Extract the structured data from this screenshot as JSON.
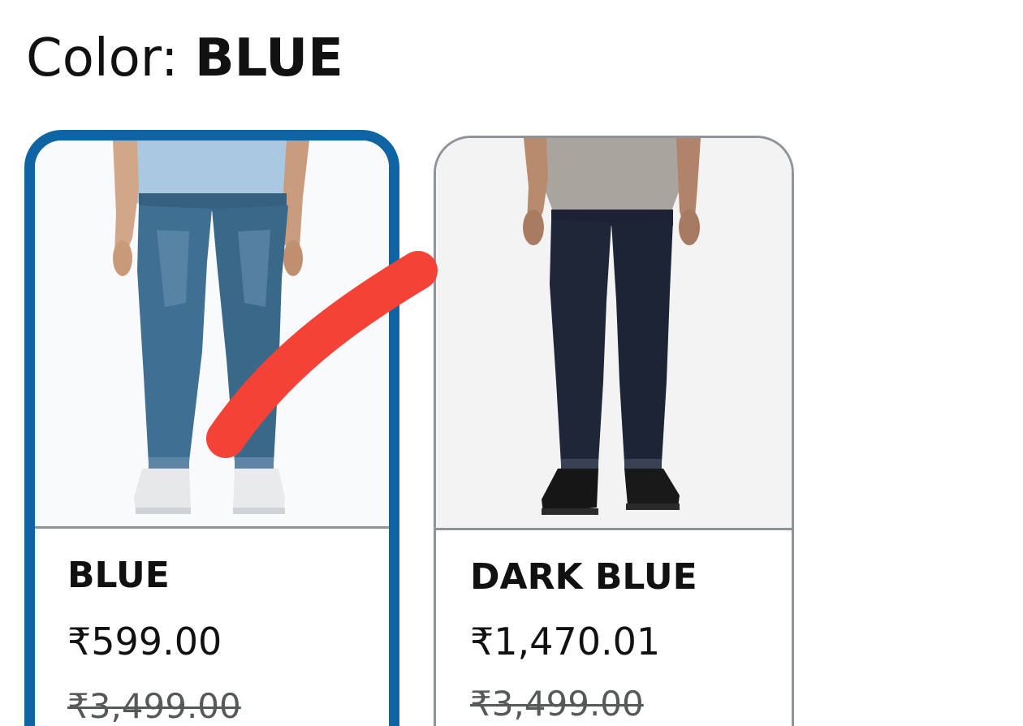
{
  "color_selector": {
    "label_prefix": "Color:",
    "selected_value": "BLUE"
  },
  "swatches": [
    {
      "name": "BLUE",
      "price": "₹599.00",
      "mrp": "₹3,499.00",
      "selected": true,
      "image": "model-wearing-blue-faded-jeans-white-sneakers"
    },
    {
      "name": "DARK BLUE",
      "price": "₹1,470.01",
      "mrp": "₹3,499.00",
      "selected": false,
      "image": "model-wearing-dark-blue-jeans-black-shoes"
    }
  ],
  "annotation": {
    "type": "red-check-mark-stroke",
    "color": "#f44336"
  },
  "colors": {
    "selected_border": "#0f65a3",
    "unselected_border": "#8e9499",
    "text": "#111111",
    "strikethrough_text": "#565959"
  }
}
